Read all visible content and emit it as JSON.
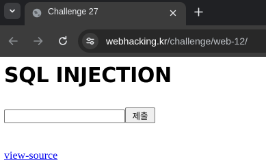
{
  "browser": {
    "tab": {
      "title": "Challenge 27",
      "favicon": "globe-icon",
      "close_icon": "close-icon"
    },
    "tab_menu_icon": "chevron-down-icon",
    "new_tab_icon": "plus-icon",
    "nav": {
      "back_icon": "arrow-left-icon",
      "forward_icon": "arrow-right-icon",
      "reload_icon": "reload-icon"
    },
    "address_bar": {
      "site_info_icon": "tune-icon",
      "host": "webhacking.kr",
      "path": "/challenge/web-12/"
    },
    "colors": {
      "tabstrip": "#202124",
      "toolbar": "#3c3c3c",
      "omnibox": "#282828"
    }
  },
  "page": {
    "heading": "SQL INJECTION",
    "form": {
      "input_value": "",
      "submit_label": "제출"
    },
    "source_link": "view-source",
    "colors": {
      "link": "#0000ee"
    }
  }
}
